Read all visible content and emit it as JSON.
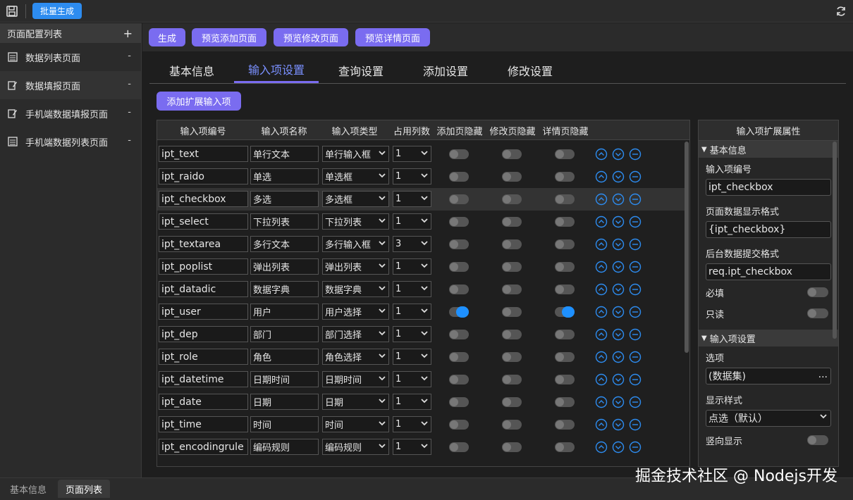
{
  "topbar": {
    "batch_label": "批量生成"
  },
  "sidebar": {
    "title": "页面配置列表",
    "add": "+",
    "items": [
      {
        "label": "数据列表页面",
        "dash": "-"
      },
      {
        "label": "数据填报页面",
        "dash": "-"
      },
      {
        "label": "手机端数据填报页面",
        "dash": "-"
      },
      {
        "label": "手机端数据列表页面",
        "dash": "-"
      }
    ]
  },
  "toolbar": {
    "generate": "生成",
    "preview_add": "预览添加页面",
    "preview_edit": "预览修改页面",
    "preview_detail": "预览详情页面"
  },
  "tabs": [
    "基本信息",
    "输入项设置",
    "查询设置",
    "添加设置",
    "修改设置"
  ],
  "active_tab": 1,
  "add_ext_label": "添加扩展输入项",
  "grid": {
    "headers": [
      "输入项编号",
      "输入项名称",
      "输入项类型",
      "占用列数",
      "添加页隐藏",
      "修改页隐藏",
      "详情页隐藏"
    ],
    "rows": [
      {
        "code": "ipt_text",
        "name": "单行文本",
        "type": "单行输入框",
        "cols": "1",
        "h_add": false,
        "h_edit": false,
        "h_detail": false
      },
      {
        "code": "ipt_raido",
        "name": "单选",
        "type": "单选框",
        "cols": "1",
        "h_add": false,
        "h_edit": false,
        "h_detail": false
      },
      {
        "code": "ipt_checkbox",
        "name": "多选",
        "type": "多选框",
        "cols": "1",
        "h_add": false,
        "h_edit": false,
        "h_detail": false
      },
      {
        "code": "ipt_select",
        "name": "下拉列表",
        "type": "下拉列表",
        "cols": "1",
        "h_add": false,
        "h_edit": false,
        "h_detail": false
      },
      {
        "code": "ipt_textarea",
        "name": "多行文本",
        "type": "多行输入框",
        "cols": "3",
        "h_add": false,
        "h_edit": false,
        "h_detail": false
      },
      {
        "code": "ipt_poplist",
        "name": "弹出列表",
        "type": "弹出列表",
        "cols": "1",
        "h_add": false,
        "h_edit": false,
        "h_detail": false
      },
      {
        "code": "ipt_datadic",
        "name": "数据字典",
        "type": "数据字典",
        "cols": "1",
        "h_add": false,
        "h_edit": false,
        "h_detail": false
      },
      {
        "code": "ipt_user",
        "name": "用户",
        "type": "用户选择",
        "cols": "1",
        "h_add": true,
        "h_edit": false,
        "h_detail": true
      },
      {
        "code": "ipt_dep",
        "name": "部门",
        "type": "部门选择",
        "cols": "1",
        "h_add": false,
        "h_edit": false,
        "h_detail": false
      },
      {
        "code": "ipt_role",
        "name": "角色",
        "type": "角色选择",
        "cols": "1",
        "h_add": false,
        "h_edit": false,
        "h_detail": false
      },
      {
        "code": "ipt_datetime",
        "name": "日期时间",
        "type": "日期时间",
        "cols": "1",
        "h_add": false,
        "h_edit": false,
        "h_detail": false
      },
      {
        "code": "ipt_date",
        "name": "日期",
        "type": "日期",
        "cols": "1",
        "h_add": false,
        "h_edit": false,
        "h_detail": false
      },
      {
        "code": "ipt_time",
        "name": "时间",
        "type": "时间",
        "cols": "1",
        "h_add": false,
        "h_edit": false,
        "h_detail": false
      },
      {
        "code": "ipt_encodingrule",
        "name": "编码规则",
        "type": "编码规则",
        "cols": "1",
        "h_add": false,
        "h_edit": false,
        "h_detail": false
      }
    ]
  },
  "panel": {
    "title": "输入项扩展属性",
    "section_basic": "基本信息",
    "code_label": "输入项编号",
    "code_value": "ipt_checkbox",
    "display_fmt_label": "页面数据显示格式",
    "display_fmt_value": "{ipt_checkbox}",
    "submit_fmt_label": "后台数据提交格式",
    "submit_fmt_value": "req.ipt_checkbox",
    "required_label": "必填",
    "readonly_label": "只读",
    "section_input": "输入项设置",
    "options_label": "选项",
    "options_value": "(数据集)",
    "options_more": "...",
    "style_label": "显示样式",
    "style_value": "点选（默认）",
    "vertical_label": "竖向显示"
  },
  "bottom_tabs": [
    "基本信息",
    "页面列表"
  ],
  "watermark": "掘金技术社区 @ Nodejs开发"
}
